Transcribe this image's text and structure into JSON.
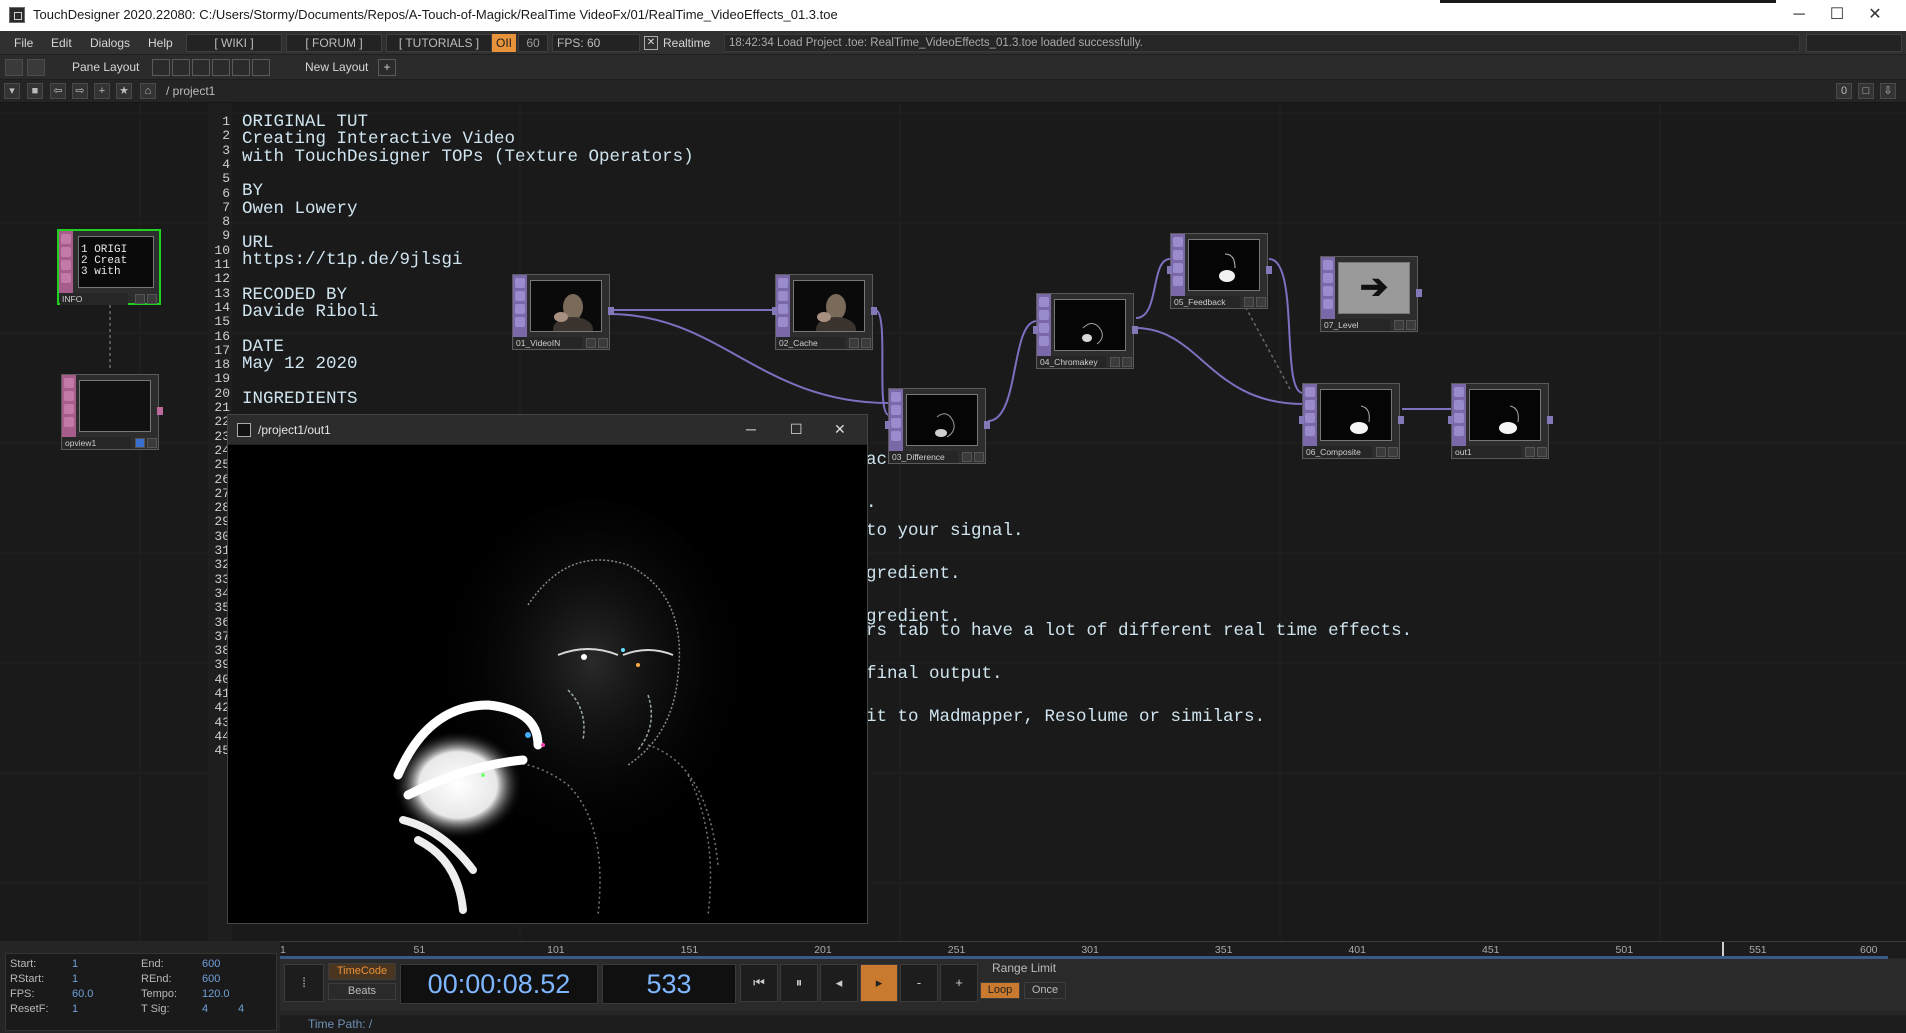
{
  "window": {
    "title": "TouchDesigner 2020.22080: C:/Users/Stormy/Documents/Repos/A-Touch-of-Magick/RealTime VideoFx/01/RealTime_VideoEffects_01.3.toe"
  },
  "menubar": {
    "items": [
      "File",
      "Edit",
      "Dialogs",
      "Help"
    ],
    "wiki": "[ WIKI ]",
    "forum": "[ FORUM ]",
    "tutorials": "[ TUTORIALS ]",
    "oi": "OII",
    "fps_badge": "60",
    "fps": "FPS:  60",
    "realtime": "Realtime",
    "status": "18:42:34 Load Project .toe: RealTime_VideoEffects_01.3.toe loaded successfully."
  },
  "toolbar": {
    "pane_layout": "Pane Layout",
    "new_layout": "New Layout",
    "plus": "+"
  },
  "pathbar": {
    "path": "/ project1",
    "counter": "0"
  },
  "info_text": {
    "line_numbers": [
      "1",
      "2",
      "3",
      "4",
      "5",
      "6",
      "7",
      "8",
      "9",
      "10",
      "11",
      "12",
      "13",
      "14",
      "15",
      "16",
      "17",
      "18",
      "19",
      "20",
      "21",
      "22",
      "23",
      "24",
      "25",
      "26",
      "27",
      "28",
      "29",
      "30",
      "31",
      "32",
      "33",
      "34",
      "35",
      "36",
      "37",
      "38",
      "39",
      "40",
      "41",
      "42",
      "43",
      "44",
      "45"
    ],
    "lines_top": [
      "ORIGINAL TUT",
      "Creating Interactive Video",
      "with TouchDesigner TOPs (Texture Operators)",
      "",
      "BY",
      "Owen Lowery",
      "",
      "URL",
      "https://t1p.de/9jlsgi",
      "",
      "RECODED BY",
      "Davide Riboli",
      "",
      "DATE",
      "May 12 2020",
      "",
      "INGREDIENTS"
    ],
    "fragments": [
      "ache.",
      ".",
      "to your signal.",
      "gredient.",
      "gredient.",
      "rs tab to have a lot of different real time effects.",
      "final output.",
      "it to Madmapper, Resolume or similars."
    ]
  },
  "nodes": {
    "info": {
      "name": "INFO",
      "preview": [
        "1 ORIGI",
        "2 Creat",
        "3 with"
      ]
    },
    "opview": {
      "name": "opview1"
    },
    "video_in": {
      "name": "01_VideoIN"
    },
    "cache": {
      "name": "02_Cache"
    },
    "difference": {
      "name": "03_Difference"
    },
    "chromakey": {
      "name": "04_Chromakey"
    },
    "feedback": {
      "name": "05_Feedback"
    },
    "composite": {
      "name": "06_Composite"
    },
    "level": {
      "name": "07_Level"
    },
    "out": {
      "name": "out1"
    }
  },
  "viewer": {
    "title": "/project1/out1",
    "minimize": "─",
    "maximize": "☐",
    "close": "✕"
  },
  "timeline": {
    "ticks": [
      "1",
      "51",
      "101",
      "151",
      "201",
      "251",
      "301",
      "351",
      "401",
      "451",
      "501",
      "551",
      "600"
    ]
  },
  "stats": {
    "start_label": "Start:",
    "start": "1",
    "rstart_label": "RStart:",
    "rstart": "1",
    "fps_label": "FPS:",
    "fps": "60.0",
    "resetf_label": "ResetF:",
    "resetf": "1",
    "end_label": "End:",
    "end": "600",
    "rend_label": "REnd:",
    "rend": "600",
    "tempo_label": "Tempo:",
    "tempo": "120.0",
    "tsig_label": "T Sig:",
    "tsig_a": "4",
    "tsig_b": "4"
  },
  "transport": {
    "timecode_btn": "TimeCode",
    "beats_btn": "Beats",
    "timecode": "00:00:08.52",
    "frame": "533",
    "range_limit": "Range Limit",
    "loop": "Loop",
    "once": "Once",
    "minus": "-",
    "plus": "+"
  },
  "timepath": {
    "text": "Time Path: /"
  },
  "colors": {
    "accent": "#e8923a",
    "wire": "#7f6fc0",
    "info_border": "#1fd020",
    "node_strip": "#7a68a8"
  }
}
